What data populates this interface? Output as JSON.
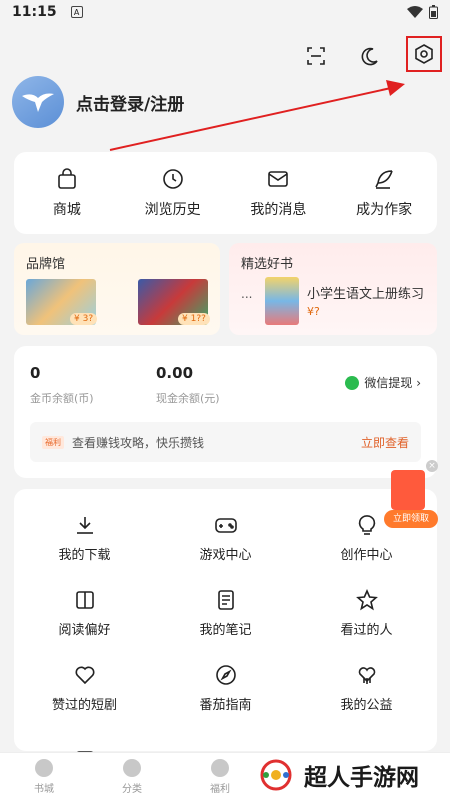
{
  "status_bar": {
    "time": "11:15",
    "badge": "A"
  },
  "header": {
    "login_text": "点击登录/注册"
  },
  "nav": [
    {
      "label": "商城",
      "icon": "bag-icon"
    },
    {
      "label": "浏览历史",
      "icon": "clock-icon"
    },
    {
      "label": "我的消息",
      "icon": "mail-icon"
    },
    {
      "label": "成为作家",
      "icon": "feather-icon"
    }
  ],
  "promo": {
    "brand": {
      "title": "品牌馆",
      "price1": "¥ 3?",
      "price2": "¥ 1??"
    },
    "books": {
      "title": "精选好书",
      "dots": "...",
      "book_title": "小学生语文上册练习",
      "price": "¥?"
    }
  },
  "wallet": {
    "coins": "0",
    "coins_label": "金币余额(币)",
    "cash": "0.00",
    "cash_label": "现金余额(元)",
    "wechat_label": "微信提现 ›",
    "earn_tag": "福利",
    "earn_text": "查看赚钱攻略，快乐攒钱",
    "earn_go": "立即查看"
  },
  "grid": [
    {
      "label": "我的下载",
      "icon": "download-icon"
    },
    {
      "label": "游戏中心",
      "icon": "gamepad-icon"
    },
    {
      "label": "创作中心",
      "icon": "lightbulb-icon"
    },
    {
      "label": "阅读偏好",
      "icon": "book-icon"
    },
    {
      "label": "我的笔记",
      "icon": "note-icon"
    },
    {
      "label": "看过的人",
      "icon": "star-icon"
    },
    {
      "label": "赞过的短剧",
      "icon": "heart-icon"
    },
    {
      "label": "番茄指南",
      "icon": "compass-icon"
    },
    {
      "label": "我的公益",
      "icon": "charity-icon"
    },
    {
      "label": "",
      "icon": "feedback-icon"
    }
  ],
  "redpacket": {
    "label": "立即领取"
  },
  "tabbar": [
    {
      "label": "书城"
    },
    {
      "label": "分类"
    },
    {
      "label": "福利"
    }
  ],
  "watermark": {
    "text": "超人手游网"
  },
  "colors": {
    "accent": "#e0622a",
    "highlight": "#e02020",
    "wechat": "#2bbb4f"
  }
}
